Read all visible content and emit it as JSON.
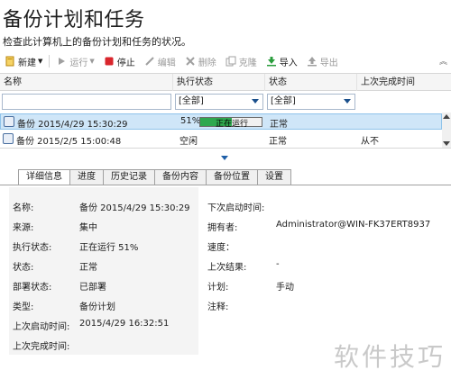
{
  "header": {
    "title": "备份计划和任务",
    "subtitle": "检查此计算机上的备份计划和任务的状况。"
  },
  "toolbar": {
    "new": "新建",
    "run": "运行",
    "stop": "停止",
    "edit": "编辑",
    "delete": "删除",
    "clone": "克隆",
    "import": "导入",
    "export": "导出"
  },
  "grid": {
    "columns": [
      "名称",
      "执行状态",
      "状态",
      "上次完成时间"
    ],
    "filters": {
      "exec": "[全部]",
      "status": "[全部]"
    },
    "rows": [
      {
        "name": "备份 2015/4/29 15:30:29",
        "percent": "51%",
        "progress": 0.51,
        "run_label": "正在运行",
        "status": "正常",
        "last": ""
      },
      {
        "name": "备份 2015/2/5 15:00:48",
        "percent": "",
        "progress": null,
        "run_label": "空闲",
        "status": "正常",
        "last": "从不"
      }
    ]
  },
  "tabs": [
    "详细信息",
    "进度",
    "历史记录",
    "备份内容",
    "备份位置",
    "设置"
  ],
  "details": {
    "left": [
      {
        "label": "名称:",
        "value": "备份 2015/4/29 15:30:29"
      },
      {
        "label": "来源:",
        "value": "集中"
      },
      {
        "label": "执行状态:",
        "value": "正在运行 51%"
      },
      {
        "label": "状态:",
        "value": "正常"
      },
      {
        "label": "部署状态:",
        "value": "已部署"
      },
      {
        "label": "类型:",
        "value": "备份计划"
      },
      {
        "label": "上次启动时间:",
        "value": "2015/4/29 16:32:51"
      },
      {
        "label": "上次完成时间:",
        "value": ""
      }
    ],
    "right": [
      {
        "label": "下次启动时间:",
        "value": ""
      },
      {
        "label": "拥有者:",
        "value": "Administrator@WIN-FK37ERT8937"
      },
      {
        "label": "速度：",
        "value": ""
      },
      {
        "label": "上次结果:",
        "value": "-"
      },
      {
        "label": "计划:",
        "value": "手动"
      },
      {
        "label": "注释:",
        "value": ""
      }
    ]
  },
  "watermark": "软件技巧",
  "colors": {
    "progress": "#2fa84f",
    "selection": "#cfe6f8",
    "stop": "#d9262c",
    "import": "#2a9d3c"
  }
}
